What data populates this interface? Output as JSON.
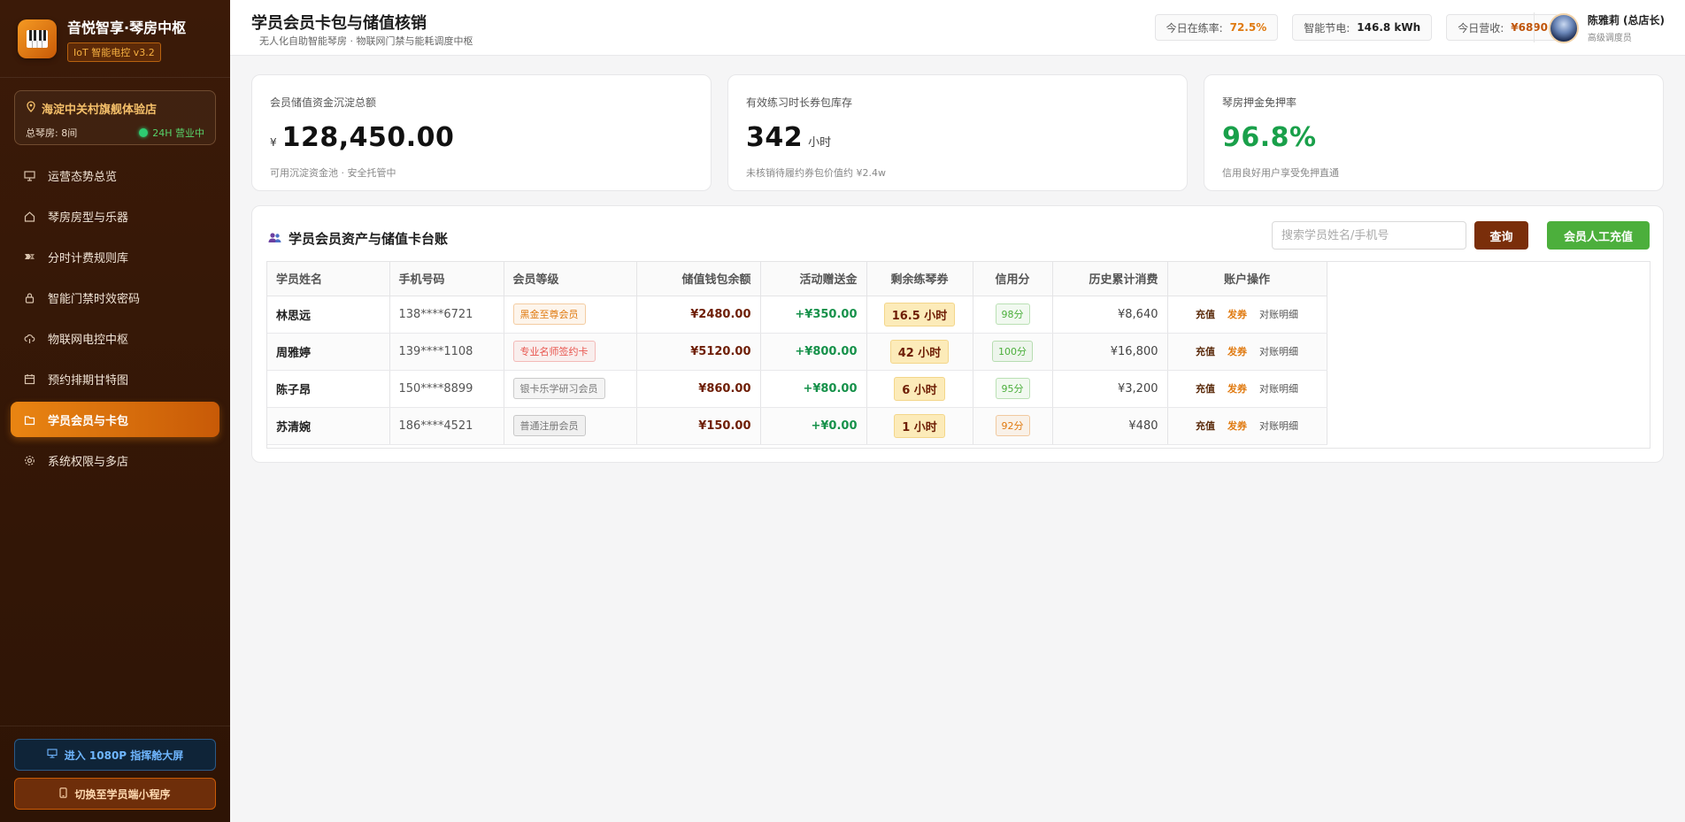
{
  "brand": {
    "title": "音悦智享·琴房中枢",
    "version": "IoT 智能电控 v3.2"
  },
  "store": {
    "name": "海淀中关村旗舰体验店",
    "rooms": "总琴房: 8间",
    "status": "24H 营业中"
  },
  "nav": [
    {
      "label": "运营态势总览",
      "icon": "dashboard-icon"
    },
    {
      "label": "琴房房型与乐器",
      "icon": "home-icon"
    },
    {
      "label": "分时计费规则库",
      "icon": "pricing-icon"
    },
    {
      "label": "智能门禁时效密码",
      "icon": "lock-icon"
    },
    {
      "label": "物联网电控中枢",
      "icon": "cloud-icon"
    },
    {
      "label": "预约排期甘特图",
      "icon": "calendar-icon"
    },
    {
      "label": "学员会员与卡包",
      "icon": "folder-icon",
      "active": true
    },
    {
      "label": "系统权限与多店",
      "icon": "gear-icon"
    }
  ],
  "footer": {
    "screen_btn": "进入 1080P 指挥舱大屏",
    "mini_btn": "切换至学员端小程序"
  },
  "header": {
    "title": "学员会员卡包与储值核销",
    "subtitle": "无人化自助智能琴房 · 物联网门禁与能耗调度中枢",
    "stats": [
      {
        "label": "今日在练率:",
        "value": "72.5%"
      },
      {
        "label": "智能节电:",
        "value": "146.8 kWh"
      },
      {
        "label": "今日营收:",
        "value": "¥6890"
      }
    ],
    "user": {
      "name": "陈雅莉 (总店长)",
      "role": "高级调度员"
    }
  },
  "kpis": [
    {
      "label": "会员储值资金沉淀总额",
      "currency": "¥",
      "value": "128,450.00",
      "unit": "",
      "note": "可用沉淀资金池 · 安全托管中"
    },
    {
      "label": "有效练习时长券包库存",
      "currency": "",
      "value": "342",
      "unit": "小时",
      "note": "未核销待履约券包价值约 ¥2.4w"
    },
    {
      "label": "琴房押金免押率",
      "currency": "",
      "value": "96.8%",
      "unit": "",
      "note": "信用良好用户享受免押直通"
    }
  ],
  "panel": {
    "title": "学员会员资产与储值卡台账",
    "search_placeholder": "搜索学员姓名/手机号",
    "query_btn": "查询",
    "recharge_btn": "会员人工充值"
  },
  "table": {
    "headers": [
      "学员姓名",
      "手机号码",
      "会员等级",
      "储值钱包余额",
      "活动赠送金",
      "剩余练琴券",
      "信用分",
      "历史累计消费",
      "账户操作"
    ],
    "ops": [
      "充值",
      "发券",
      "对账明细"
    ],
    "rows": [
      {
        "name": "林思远",
        "phone": "138****6721",
        "level": "黑金至尊会员",
        "level_color": "#e07a10",
        "balance": "¥2480.00",
        "bonus": "+¥350.00",
        "hours": "16.5 小时",
        "credit": "98分",
        "credit_color": "#4caf3c",
        "total": "¥8,640"
      },
      {
        "name": "周雅婷",
        "phone": "139****1108",
        "level": "专业名师签约卡",
        "level_color": "#e8554e",
        "balance": "¥5120.00",
        "bonus": "+¥800.00",
        "hours": "42 小时",
        "credit": "100分",
        "credit_color": "#4caf3c",
        "total": "¥16,800"
      },
      {
        "name": "陈子昂",
        "phone": "150****8899",
        "level": "银卡乐学研习会员",
        "level_color": "#777777",
        "balance": "¥860.00",
        "bonus": "+¥80.00",
        "hours": "6 小时",
        "credit": "95分",
        "credit_color": "#4caf3c",
        "total": "¥3,200"
      },
      {
        "name": "苏清婉",
        "phone": "186****4521",
        "level": "普通注册会员",
        "level_color": "#777777",
        "balance": "¥150.00",
        "bonus": "+¥0.00",
        "hours": "1 小时",
        "credit": "92分",
        "credit_color": "#e07a10",
        "total": "¥480"
      }
    ]
  }
}
